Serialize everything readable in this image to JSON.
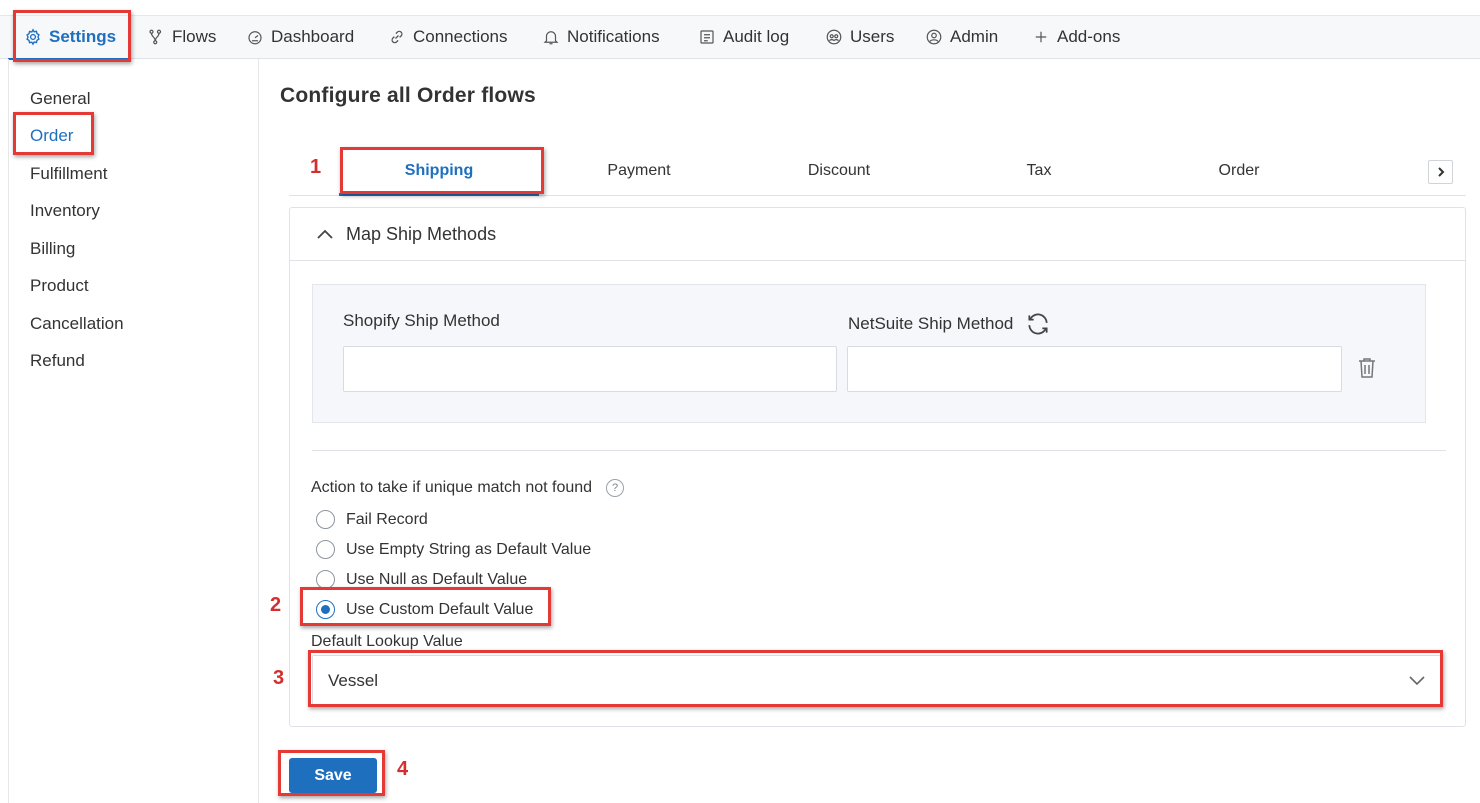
{
  "topnav": {
    "items": [
      {
        "label": "Settings",
        "icon": "gear-icon",
        "active": true
      },
      {
        "label": "Flows",
        "icon": "flow-icon"
      },
      {
        "label": "Dashboard",
        "icon": "dashboard-icon"
      },
      {
        "label": "Connections",
        "icon": "link-icon"
      },
      {
        "label": "Notifications",
        "icon": "bell-icon"
      },
      {
        "label": "Audit log",
        "icon": "audit-icon"
      },
      {
        "label": "Users",
        "icon": "users-icon"
      },
      {
        "label": "Admin",
        "icon": "admin-icon"
      },
      {
        "label": "Add-ons",
        "icon": "plus-icon"
      }
    ]
  },
  "sidebar": {
    "items": [
      {
        "label": "General"
      },
      {
        "label": "Order",
        "active": true
      },
      {
        "label": "Fulfillment"
      },
      {
        "label": "Inventory"
      },
      {
        "label": "Billing"
      },
      {
        "label": "Product"
      },
      {
        "label": "Cancellation"
      },
      {
        "label": "Refund"
      }
    ]
  },
  "main": {
    "title": "Configure all Order flows",
    "tabs": [
      {
        "label": "Shipping",
        "active": true
      },
      {
        "label": "Payment"
      },
      {
        "label": "Discount"
      },
      {
        "label": "Tax"
      },
      {
        "label": "Order"
      }
    ],
    "section": {
      "title": "Map Ship Methods",
      "shopify_label": "Shopify Ship Method",
      "netsuite_label": "NetSuite Ship Method",
      "shopify_value": "",
      "netsuite_value": ""
    },
    "action": {
      "label": "Action to take if unique match not found",
      "help": "?",
      "options": [
        {
          "label": "Fail Record",
          "checked": false
        },
        {
          "label": "Use Empty String as Default Value",
          "checked": false
        },
        {
          "label": "Use Null as Default Value",
          "checked": false
        },
        {
          "label": "Use Custom Default Value",
          "checked": true
        }
      ]
    },
    "lookup": {
      "label": "Default Lookup Value",
      "value": "Vessel"
    },
    "save_label": "Save"
  },
  "annotations": [
    "1",
    "2",
    "3",
    "4"
  ],
  "colors": {
    "accent": "#1f6fbf",
    "callout": "#e53935"
  }
}
